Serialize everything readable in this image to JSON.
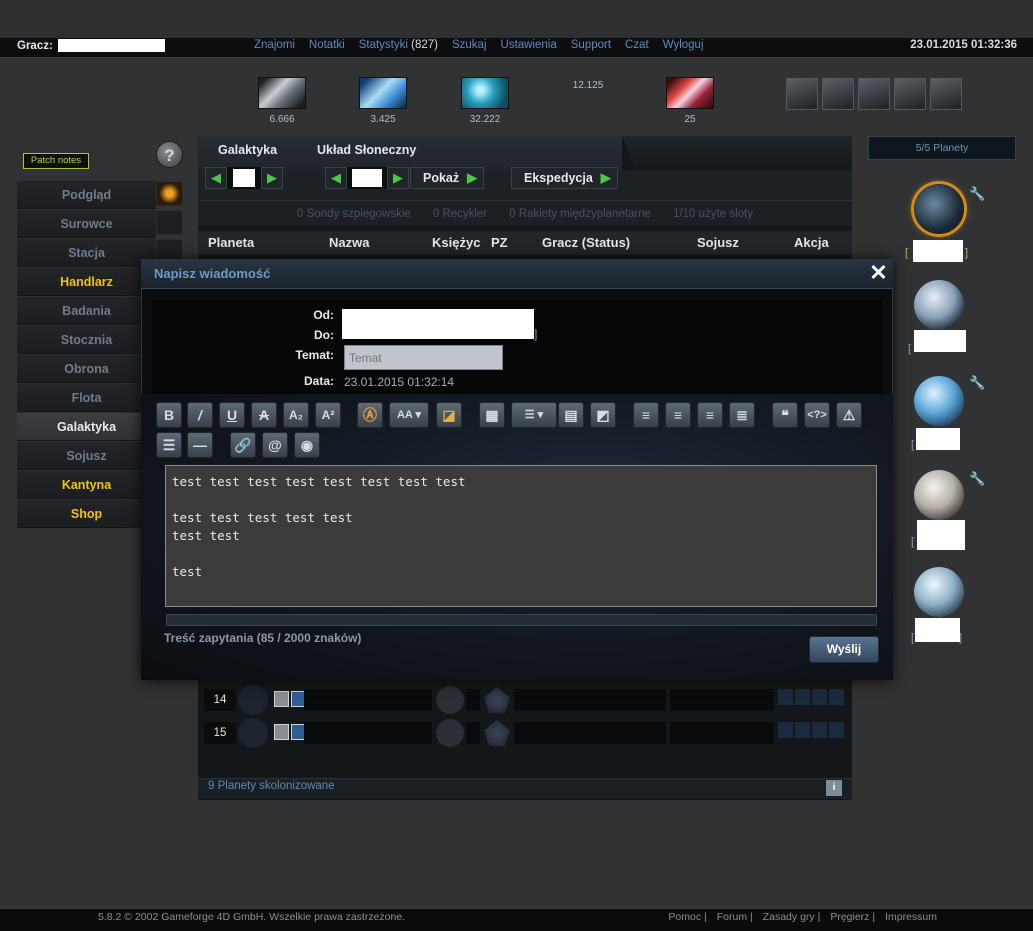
{
  "header": {
    "player_label": "Gracz:",
    "nav": [
      "Znajomi",
      "Notatki",
      "Statystyki",
      "Szukaj",
      "Ustawienia",
      "Support",
      "Czat",
      "Wyloguj"
    ],
    "stats_rank": "(827)",
    "clock": "23.01.2015 01:32:36"
  },
  "resources": {
    "metal": "6.666",
    "crystal": "3.425",
    "deuterium": "32.222",
    "energy": "12.125",
    "dark_matter": "25"
  },
  "left_menu": {
    "patch_notes": "Patch notes",
    "help": "?",
    "items": [
      {
        "label": "Podgląd",
        "style": "normal"
      },
      {
        "label": "Surowce",
        "style": "normal"
      },
      {
        "label": "Stacja",
        "style": "normal"
      },
      {
        "label": "Handlarz",
        "style": "gold"
      },
      {
        "label": "Badania",
        "style": "normal"
      },
      {
        "label": "Stocznia",
        "style": "normal"
      },
      {
        "label": "Obrona",
        "style": "normal"
      },
      {
        "label": "Flota",
        "style": "normal"
      },
      {
        "label": "Galaktyka",
        "style": "active"
      },
      {
        "label": "Sojusz",
        "style": "normal"
      },
      {
        "label": "Kantyna",
        "style": "gold"
      },
      {
        "label": "Shop",
        "style": "gold"
      }
    ]
  },
  "galaxy": {
    "galaxy_label": "Galaktyka",
    "system_label": "Układ Słoneczny",
    "show_btn": "Pokaż",
    "expedition_btn": "Ekspedycja",
    "slots": [
      "0 Sondy szpiegowskie",
      "0 Recykler",
      "0 Rakiety międzyplanetarne",
      "1/10 użyte sloty"
    ],
    "columns": [
      "Planeta",
      "Nazwa",
      "Księżyc",
      "PZ",
      "Gracz (Status)",
      "Sojusz",
      "Akcja"
    ],
    "rows": [
      {
        "pos": "14"
      },
      {
        "pos": "15"
      }
    ],
    "colonized": "9 Planety skolonizowane",
    "info_icon": "i"
  },
  "planets": {
    "count_label": "5/5 Planety",
    "items": [
      {
        "has_wrench": true
      },
      {
        "has_wrench": false
      },
      {
        "has_wrench": true
      },
      {
        "has_wrench": true
      },
      {
        "has_wrench": false
      }
    ]
  },
  "message_dialog": {
    "title": "Napisz wiadomość",
    "close": "✕",
    "from_label": "Od:",
    "to_label": "Do:",
    "subject_label": "Temat:",
    "subject_placeholder": "Temat",
    "date_label": "Data:",
    "date_value": "23.01.2015 01:32:14",
    "body": "test test test test test test test test\n\ntest test test test test\ntest test\n\ntest ",
    "char_count": "Treść zapytania (85 / 2000 znaków)",
    "send": "Wyślij",
    "toolbar": [
      "bold-icon",
      "italic-icon",
      "underline-icon",
      "strikethrough-icon",
      "subscript-icon",
      "superscript-icon",
      "color-icon",
      "font-size-icon",
      "background-color-icon",
      "image-icon",
      "list-style-icon",
      "table-icon",
      "embed-icon",
      "align-left-icon",
      "align-center-icon",
      "align-right-icon",
      "align-justify-icon",
      "quote-icon",
      "code-icon",
      "spoiler-warning-icon",
      "bullet-list-icon",
      "horizontal-rule-icon",
      "link-icon",
      "email-icon",
      "preview-icon"
    ]
  },
  "footer": {
    "copyright": "5.8.2  © 2002 Gameforge 4D GmbH. Wszelkie prawa zastrzeżone.",
    "links": [
      "Pomoc |",
      "Forum |",
      "Zasady gry |",
      "Pręgierz |",
      "Impressum"
    ]
  }
}
